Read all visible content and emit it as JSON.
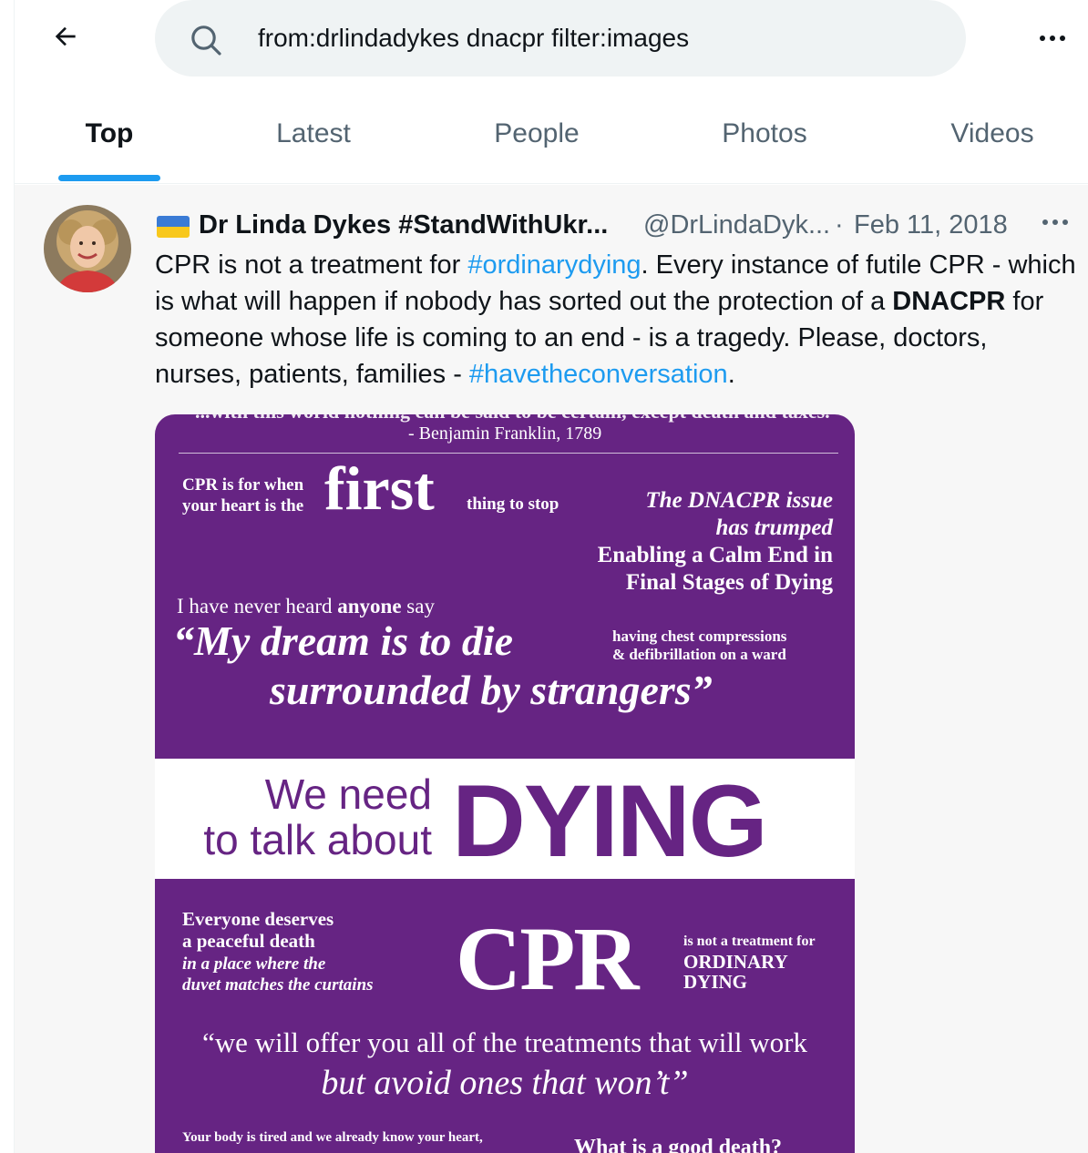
{
  "search": {
    "query": "from:drlindadykes dnacpr filter:images"
  },
  "tabs": [
    {
      "label": "Top",
      "active": true
    },
    {
      "label": "Latest",
      "active": false
    },
    {
      "label": "People",
      "active": false
    },
    {
      "label": "Photos",
      "active": false
    },
    {
      "label": "Videos",
      "active": false
    }
  ],
  "tweet": {
    "display_name": "Dr Linda Dykes #StandWithUkr...",
    "handle": "@DrLindaDyk...",
    "separator": "·",
    "date": "Feb 11, 2018",
    "text": {
      "t1": "CPR is not a treatment for ",
      "tag1": "#ordinarydying",
      "t2": ". Every instance of futile CPR - which is what will happen if nobody has sorted out the protection of a ",
      "bold": "DNACPR",
      "t3": " for someone whose life is coming to an end - is a tragedy. Please, doctors, nurses, patients, families - ",
      "tag2": "#havetheconversation",
      "t4": "."
    }
  },
  "poster": {
    "cut_top": "...with this world nothing can be said to be certain, except death and taxes.",
    "franklin": "- Benjamin Franklin, 1789",
    "cpr_first_1": "CPR is for when",
    "cpr_first_2": "your heart is the",
    "first_word": "first",
    "first_after": "thing to stop",
    "dnacpr_issue_1": "The DNACPR issue",
    "dnacpr_issue_2": "has trumped",
    "enabling_1": "Enabling a Calm End in",
    "enabling_2": "Final Stages of Dying",
    "never_1": "I have never heard ",
    "never_bold": "anyone",
    "never_2": " say",
    "dream": "“My dream is to die",
    "having_1": "having chest compressions",
    "having_2": "& defibrillation on a ward",
    "strangers": "surrounded by strangers”",
    "weneed_1": "We need",
    "weneed_2": "to talk about",
    "dying": "DYING",
    "everyone_1": "Everyone deserves",
    "everyone_2": "a peaceful death",
    "duvet_1": "in a place where the",
    "duvet_2": "duvet matches the curtains",
    "cpr": "CPR",
    "notreat_1": "is not a treatment for",
    "notreat_2": "ORDINARY",
    "notreat_3": "DYING",
    "offer": "“we will offer you all of the treatments that will work",
    "avoid": "but avoid ones that won’t”",
    "tired": "Your body is tired and we already know your heart,",
    "gooddeath": "What is a good death?"
  },
  "colors": {
    "accent": "#1d9bf0",
    "poster_purple": "#662483",
    "flag_blue": "#3a7bd5",
    "flag_yellow": "#f8c81c"
  },
  "icons": [
    "back-arrow-icon",
    "search-icon",
    "more-icon",
    "ukraine-flag-icon"
  ]
}
